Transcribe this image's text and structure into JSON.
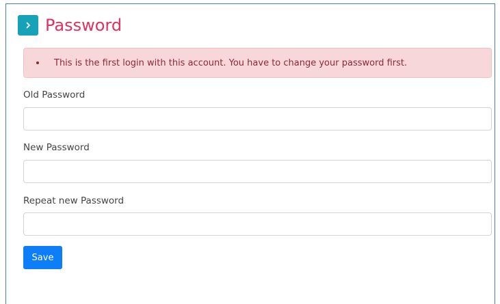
{
  "colors": {
    "accent_teal": "#17a2b8",
    "title_pink": "#e0305f",
    "alert_bg": "#f8d7da",
    "alert_text": "#8b2a35",
    "primary_blue": "#0d7ef8",
    "window_border": "#4a7ab8"
  },
  "header": {
    "icon": "chevron-right-icon",
    "title": "Password"
  },
  "alert": {
    "message": "This is the first login with this account. You have to change your password first."
  },
  "form": {
    "old_password": {
      "label": "Old Password",
      "value": "",
      "placeholder": ""
    },
    "new_password": {
      "label": "New Password",
      "value": "",
      "placeholder": ""
    },
    "repeat_password": {
      "label": "Repeat new Password",
      "value": "",
      "placeholder": ""
    },
    "save_label": "Save"
  }
}
